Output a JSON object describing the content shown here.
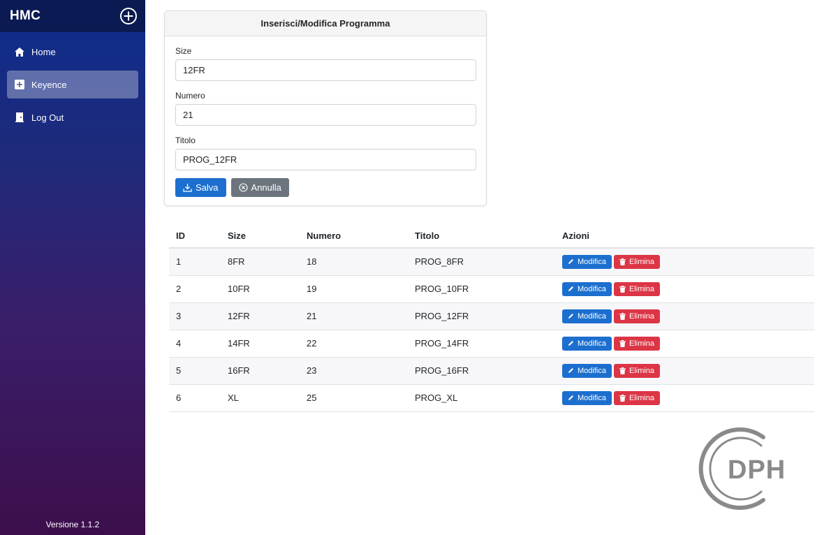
{
  "sidebar": {
    "brand": "HMC",
    "items": [
      {
        "label": "Home",
        "icon": "home-icon"
      },
      {
        "label": "Keyence",
        "icon": "plus-square-icon",
        "active": true
      },
      {
        "label": "Log Out",
        "icon": "door-icon"
      }
    ],
    "version": "Versione 1.1.2"
  },
  "form": {
    "title": "Inserisci/Modifica Programma",
    "size_label": "Size",
    "size_value": "12FR",
    "numero_label": "Numero",
    "numero_value": "21",
    "titolo_label": "Titolo",
    "titolo_value": "PROG_12FR",
    "save_label": "Salva",
    "cancel_label": "Annulla"
  },
  "table": {
    "headers": [
      "ID",
      "Size",
      "Numero",
      "Titolo",
      "Azioni"
    ],
    "edit_label": "Modifica",
    "delete_label": "Elimina",
    "rows": [
      {
        "id": "1",
        "size": "8FR",
        "numero": "18",
        "titolo": "PROG_8FR"
      },
      {
        "id": "2",
        "size": "10FR",
        "numero": "19",
        "titolo": "PROG_10FR"
      },
      {
        "id": "3",
        "size": "12FR",
        "numero": "21",
        "titolo": "PROG_12FR"
      },
      {
        "id": "4",
        "size": "14FR",
        "numero": "22",
        "titolo": "PROG_14FR"
      },
      {
        "id": "5",
        "size": "16FR",
        "numero": "23",
        "titolo": "PROG_16FR"
      },
      {
        "id": "6",
        "size": "XL",
        "numero": "25",
        "titolo": "PROG_XL"
      }
    ]
  },
  "logo": {
    "text": "DPH"
  },
  "colors": {
    "primary": "#1c6fce",
    "danger": "#dc3545",
    "secondary": "#6c757d",
    "sidebar_top": "#0d2d8c",
    "sidebar_bottom": "#3c0f4c"
  }
}
